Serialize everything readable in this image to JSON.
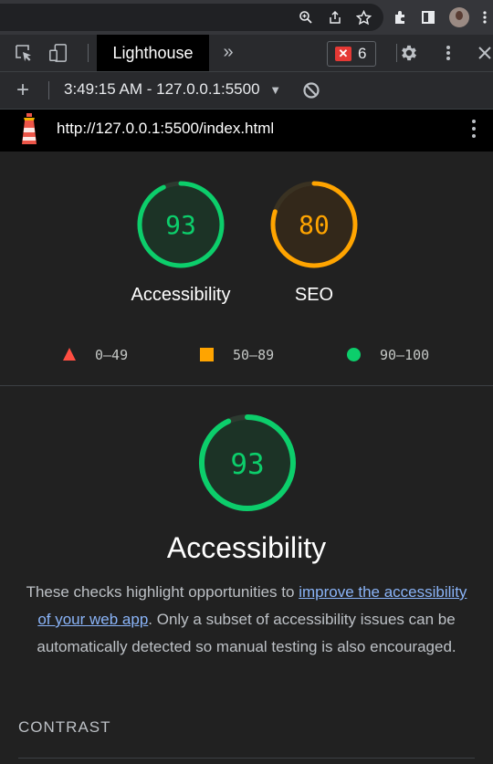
{
  "devtools": {
    "active_tab": "Lighthouse",
    "error_count": "6",
    "report_selector": "3:49:15 AM - 127.0.0.1:5500"
  },
  "report": {
    "url": "http://127.0.0.1:5500/index.html",
    "gauges": [
      {
        "label": "Accessibility",
        "score": "93",
        "fraction": 0.93,
        "color": "#0cce6b"
      },
      {
        "label": "SEO",
        "score": "80",
        "fraction": 0.8,
        "color": "#ffa400"
      }
    ],
    "legend": [
      {
        "range": "0–49",
        "color": "#ff4e42"
      },
      {
        "range": "50–89",
        "color": "#ffa400"
      },
      {
        "range": "90–100",
        "color": "#0cce6b"
      }
    ],
    "category": {
      "score": "93",
      "fraction": 0.93,
      "title": "Accessibility",
      "desc_before": "These checks highlight opportunities to ",
      "desc_link": "improve the accessibility of your web app",
      "desc_after": ". Only a subset of accessibility issues can be automatically detected so manual testing is also encouraged."
    },
    "section_title": "CONTRAST"
  }
}
